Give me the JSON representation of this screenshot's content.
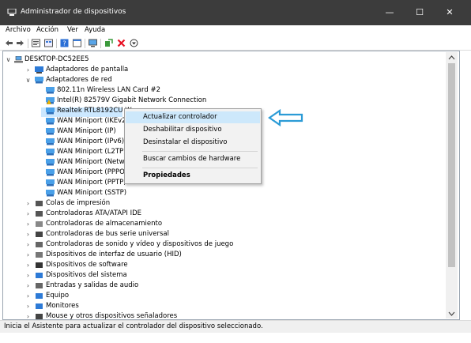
{
  "window": {
    "title": "Administrador de dispositivos",
    "minimize_glyph": "—",
    "maximize_glyph": "☐",
    "close_glyph": "✕"
  },
  "menu": [
    "Archivo",
    "Acción",
    "Ver",
    "Ayuda"
  ],
  "toolbar": {
    "icons": [
      "back-arrow-icon",
      "forward-arrow-icon",
      "properties-icon",
      "device-grid-icon",
      "help-icon",
      "view-icon",
      "monitor-icon",
      "update-driver-icon",
      "uninstall-icon",
      "enable-icon"
    ],
    "uninstall_color": "#e81123"
  },
  "tree": {
    "root": "DESKTOP-DC52EE5",
    "display_adapters": "Adaptadores de pantalla",
    "network_adapters": "Adaptadores de red",
    "network_items": [
      "802.11n Wireless LAN Card #2",
      "Intel(R) 82579V Gigabit Network Connection",
      "Realtek RTL8192CU W",
      "WAN Miniport (IKEv2",
      "WAN Miniport (IP)",
      "WAN Miniport (IPv6)",
      "WAN Miniport (L2TP)",
      "WAN Miniport (Netwo",
      "WAN Miniport (PPPO",
      "WAN Miniport (PPTP)",
      "WAN Miniport (SSTP)"
    ],
    "categories": [
      "Colas de impresión",
      "Controladoras ATA/ATAPI IDE",
      "Controladoras de almacenamiento",
      "Controladoras de bus serie universal",
      "Controladoras de sonido y vídeo y dispositivos de juego",
      "Dispositivos de interfaz de usuario (HID)",
      "Dispositivos de software",
      "Dispositivos del sistema",
      "Entradas y salidas de audio",
      "Equipo",
      "Monitores",
      "Mouse y otros dispositivos señaladores"
    ]
  },
  "context_menu": {
    "update": "Actualizar controlador",
    "disable": "Deshabilitar dispositivo",
    "uninstall": "Desinstalar el dispositivo",
    "scan": "Buscar cambios de hardware",
    "properties": "Propiedades"
  },
  "callout_color": "#2b9bd6",
  "status": "Inicia el Asistente para actualizar el controlador del dispositivo seleccionado."
}
